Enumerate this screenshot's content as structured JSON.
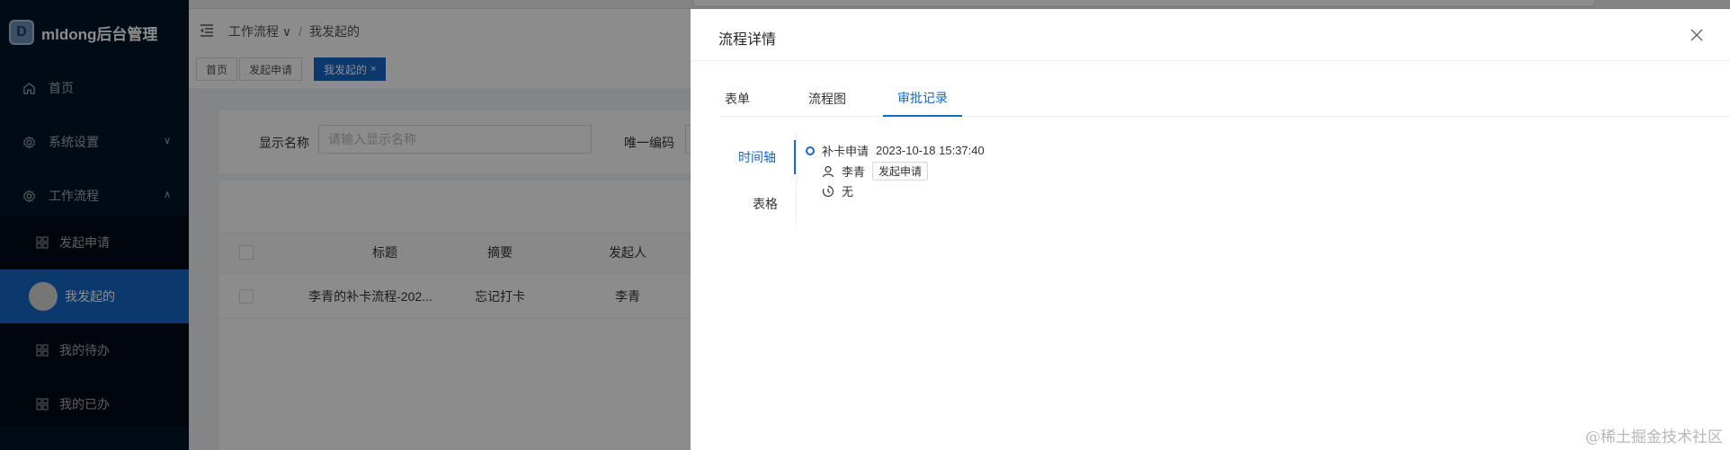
{
  "brand": {
    "name": "mldong后台管理",
    "logo_letter": "D"
  },
  "sidebar": {
    "items": [
      {
        "label": "首页",
        "icon": "home-icon"
      },
      {
        "label": "系统设置",
        "icon": "settings-icon",
        "chevron": "∨"
      },
      {
        "label": "工作流程",
        "icon": "settings-icon",
        "chevron": "∧"
      }
    ],
    "subitems": [
      {
        "label": "发起申请",
        "icon": "grid-icon"
      },
      {
        "label": "我发起的",
        "icon": "avatar",
        "active": true
      },
      {
        "label": "我的待办",
        "icon": "grid-icon"
      },
      {
        "label": "我的已办",
        "icon": "grid-icon"
      }
    ]
  },
  "header": {
    "breadcrumb": [
      "工作流程 ∨",
      "我发起的"
    ],
    "breadcrumb_sep": "/"
  },
  "tabs": [
    {
      "label": "首页"
    },
    {
      "label": "发起申请"
    },
    {
      "label": "我发起的",
      "close": "×",
      "active": true
    }
  ],
  "search": {
    "display_name_label": "显示名称",
    "display_name_placeholder": "请输入显示名称",
    "unique_code_label": "唯一编码"
  },
  "table": {
    "columns": [
      "标题",
      "摘要",
      "发起人"
    ],
    "rows": [
      {
        "title": "李青的补卡流程-202...",
        "summary": "忘记打卡",
        "initiator": "李青"
      }
    ]
  },
  "drawer": {
    "title": "流程详情",
    "tabs": [
      "表单",
      "流程图",
      "审批记录"
    ],
    "active_tab": "审批记录",
    "view_tabs": [
      "时间轴",
      "表格"
    ],
    "active_view": "时间轴",
    "timeline": {
      "node_name": "补卡申请",
      "time": "2023-10-18 15:37:40",
      "user": "李青",
      "action_tag": "发起申请",
      "comment": "无"
    }
  },
  "watermark": "@稀土掘金技术社区",
  "colors": {
    "sidebar_bg": "#001529",
    "accent": "#1668c6"
  }
}
